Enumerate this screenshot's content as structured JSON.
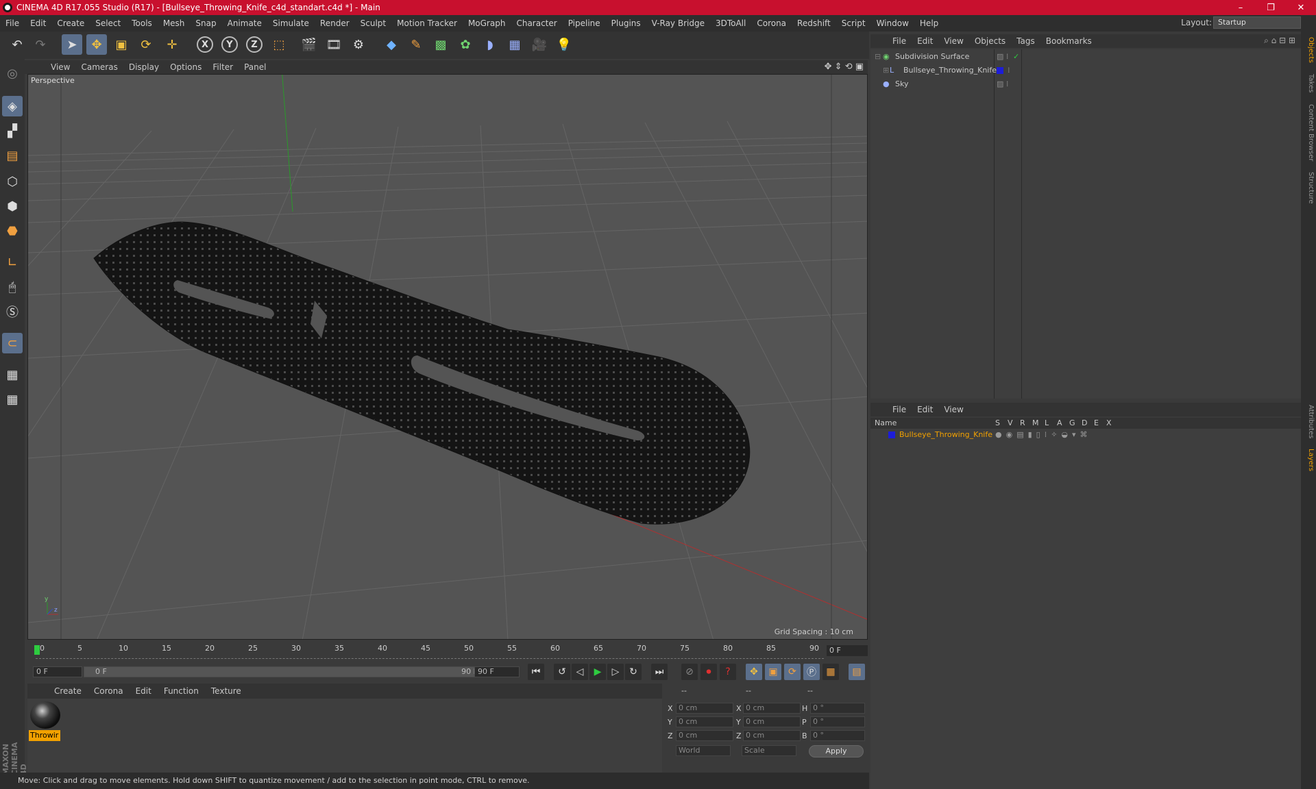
{
  "titlebar": {
    "title": "CINEMA 4D R17.055 Studio (R17) - [Bullseye_Throwing_Knife_c4d_standart.c4d *] - Main",
    "minimize": "–",
    "restore": "❐",
    "close": "✕"
  },
  "menubar": {
    "items": [
      "File",
      "Edit",
      "Create",
      "Select",
      "Tools",
      "Mesh",
      "Snap",
      "Animate",
      "Simulate",
      "Render",
      "Sculpt",
      "Motion Tracker",
      "MoGraph",
      "Character",
      "Pipeline",
      "Plugins",
      "V-Ray Bridge",
      "3DToAll",
      "Corona",
      "Redshift",
      "Script",
      "Window",
      "Help"
    ],
    "layout_label": "Layout:",
    "layout_value": "Startup"
  },
  "toolbar": {
    "axis_x": "X",
    "axis_y": "Y",
    "axis_z": "Z"
  },
  "viewport": {
    "menu": [
      "View",
      "Cameras",
      "Display",
      "Options",
      "Filter",
      "Panel"
    ],
    "label": "Perspective",
    "grid_spacing": "Grid Spacing : 10 cm"
  },
  "timeline": {
    "ticks": [
      "0",
      "5",
      "10",
      "15",
      "20",
      "25",
      "30",
      "35",
      "40",
      "45",
      "50",
      "55",
      "60",
      "65",
      "70",
      "75",
      "80",
      "85",
      "90"
    ],
    "current_frame": "0 F",
    "start_field": "0 F",
    "range_start": "0 F",
    "range_end": "90 F",
    "end_field": "90 F"
  },
  "material_manager": {
    "menu": [
      "Create",
      "Corona",
      "Edit",
      "Function",
      "Texture"
    ],
    "material_name": "Throwir"
  },
  "coordinates": {
    "headers": [
      "--",
      "--",
      "--"
    ],
    "rows": [
      {
        "axis1": "X",
        "val1": "0 cm",
        "axis2": "X",
        "val2": "0 cm",
        "axis3": "H",
        "val3": "0 °"
      },
      {
        "axis1": "Y",
        "val1": "0 cm",
        "axis2": "Y",
        "val2": "0 cm",
        "axis3": "P",
        "val3": "0 °"
      },
      {
        "axis1": "Z",
        "val1": "0 cm",
        "axis2": "Z",
        "val2": "0 cm",
        "axis3": "B",
        "val3": "0 °"
      }
    ],
    "mode_world": "World",
    "mode_scale": "Scale",
    "apply": "Apply"
  },
  "status": {
    "text": "Move: Click and drag to move elements. Hold down SHIFT to quantize movement / add to the selection in point mode, CTRL to remove."
  },
  "object_manager": {
    "menu": [
      "File",
      "Edit",
      "View",
      "Objects",
      "Tags",
      "Bookmarks"
    ],
    "objects": [
      "Subdivision Surface",
      "Bullseye_Throwing_Knife",
      "Sky"
    ]
  },
  "layer_manager": {
    "menu": [
      "File",
      "Edit",
      "View"
    ],
    "name_header": "Name",
    "col_headers": [
      "S",
      "V",
      "R",
      "M",
      "L",
      "A",
      "G",
      "D",
      "E",
      "X"
    ],
    "layers": [
      "Bullseye_Throwing_Knife"
    ]
  },
  "right_tabs": [
    "Objects",
    "Takes",
    "Content Browser",
    "Structure",
    "Attributes",
    "Layers"
  ],
  "branding": "MAXON CINEMA 4D",
  "colors": {
    "title_bar": "#c8102e",
    "selected_tool": "#5b6f8c",
    "material_highlight": "#f2a100",
    "layer_color": "#1d1dd8"
  }
}
